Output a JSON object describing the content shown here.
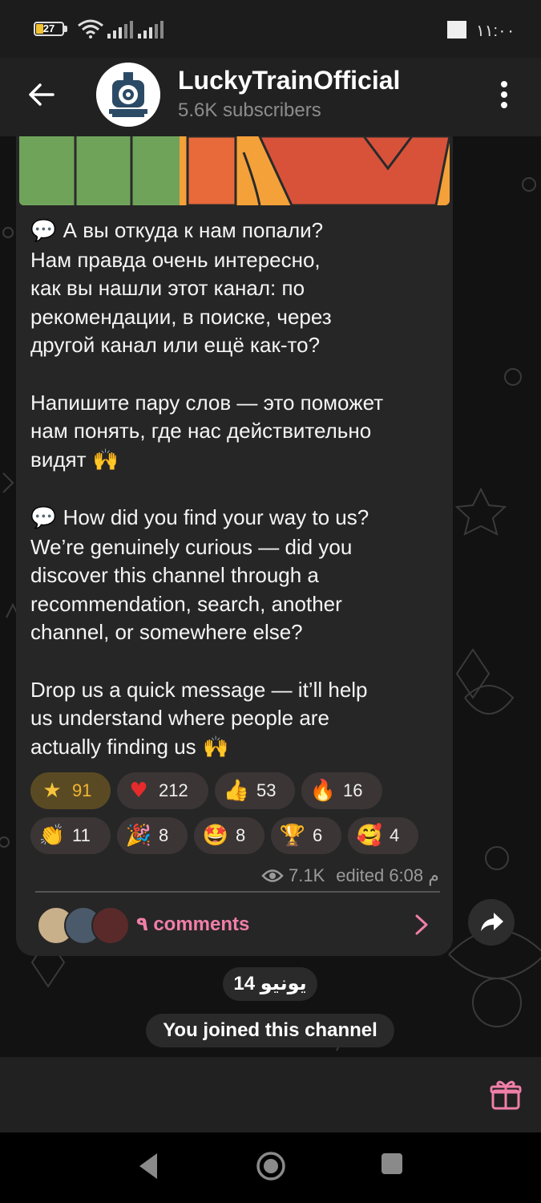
{
  "status_bar": {
    "battery": "27",
    "battery_level": 0.27,
    "time": "١١:٠٠"
  },
  "header": {
    "title": "LuckyTrainOfficial",
    "subtitle": "5.6K subscribers",
    "back_icon": "arrow-left-icon",
    "menu_icon": "more-vertical-icon"
  },
  "message": {
    "text_ru": "А вы откуда к нам попали?\nНам правда очень интересно,\nкак вы нашли этот канал: по\nрекомендации, в поиске, через\nдругой канал или ещё как-то?",
    "text_ru2": "Напишите пару слов — это поможет\nнам понять, где нас действительно\nвидят",
    "text_en": "How did you find your way to us?\nWe’re genuinely curious — did you\ndiscover this channel through a\nrecommendation, search, another\nchannel, or somewhere else?",
    "text_en2": "Drop us a quick message — it’ll help\nus understand where people are\nactually finding us",
    "reactions": [
      {
        "icon": "star-icon",
        "glyph": "★",
        "count": "91",
        "active": true
      },
      {
        "icon": "heart-icon",
        "glyph": "♥",
        "count": "212"
      },
      {
        "icon": "thumbs-up-icon",
        "glyph": "👍",
        "count": "53"
      },
      {
        "icon": "fire-icon",
        "glyph": "🔥",
        "count": "16"
      },
      {
        "icon": "clap-icon",
        "glyph": "👏",
        "count": "11"
      },
      {
        "icon": "party-popper-icon",
        "glyph": "🎉",
        "count": "8"
      },
      {
        "icon": "star-struck-icon",
        "glyph": "🤩",
        "count": "8"
      },
      {
        "icon": "trophy-icon",
        "glyph": "🏆",
        "count": "6"
      },
      {
        "icon": "smiling-hearts-icon",
        "glyph": "🥰",
        "count": "4"
      }
    ],
    "views": "7.1K",
    "edited": "edited 6:08 م",
    "comments": "٩ comments"
  },
  "date_separator": "14 يونيو",
  "service_message": "You joined this channel",
  "colors": {
    "accent_pink": "#f07fa8",
    "star_active": "#f2b632",
    "bubble_bg": "#262626",
    "header_bg": "#212121"
  }
}
